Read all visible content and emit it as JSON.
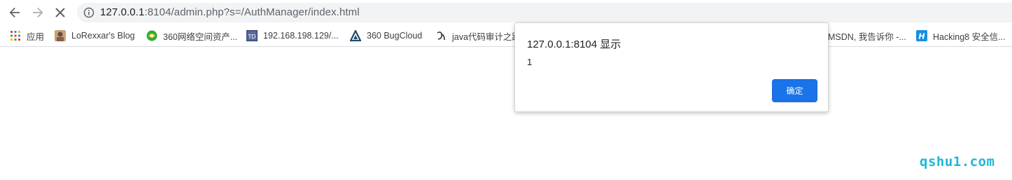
{
  "toolbar": {
    "back_icon": "arrow-left-icon",
    "forward_icon": "arrow-right-icon",
    "stop_icon": "close-icon",
    "url_host": "127.0.0.1",
    "url_rest": ":8104/admin.php?s=/AuthManager/index.html"
  },
  "bookmarks": {
    "items": [
      {
        "label": "应用",
        "icon": "apps-grid-icon"
      },
      {
        "label": "LoRexxar's Blog",
        "icon": "avatar-icon"
      },
      {
        "label": "360网络空间资产...",
        "icon": "360-globe-icon"
      },
      {
        "label": "192.168.198.129/...",
        "icon": "td-icon"
      },
      {
        "label": "360 BugCloud",
        "icon": "triangle-logo-icon"
      },
      {
        "label": "java代码审计之路",
        "icon": "script-logo-icon"
      },
      {
        "label": "MSDN, 我告诉你 -...",
        "icon": ""
      },
      {
        "label": "Hacking8 安全信...",
        "icon": "h-logo-icon"
      }
    ]
  },
  "dialog": {
    "title": "127.0.0.1:8104 显示",
    "message": "1",
    "ok_label": "确定"
  },
  "watermark": "qshu1.com",
  "colors": {
    "accent": "#1a73e8",
    "watermark": "#1eb6d8",
    "omnibox_bg": "#f1f3f4"
  }
}
